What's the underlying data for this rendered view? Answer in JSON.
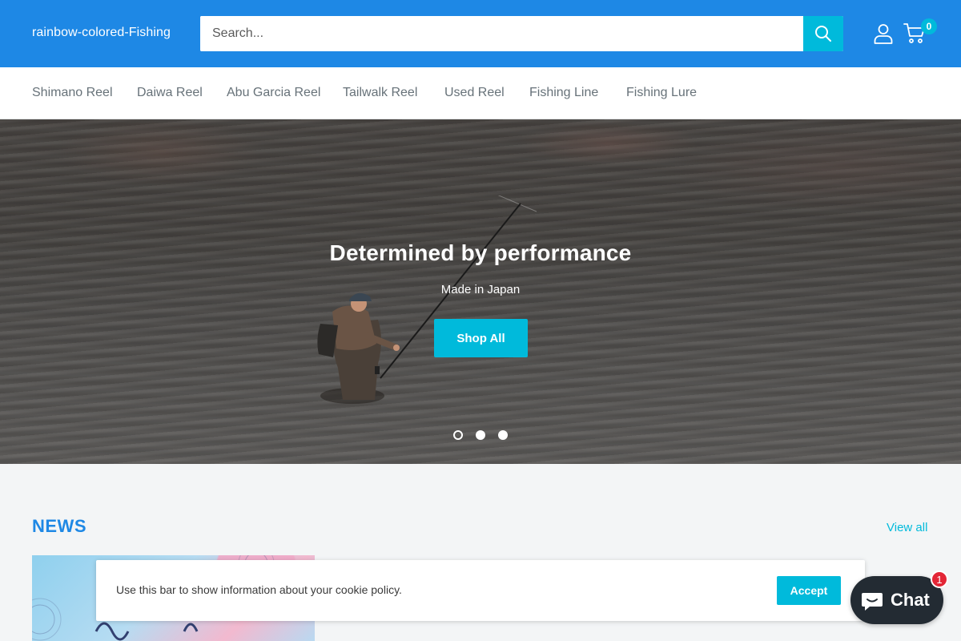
{
  "header": {
    "logo": "rainbow-colored-Fishing",
    "search_placeholder": "Search...",
    "cart_count": "0",
    "icons": {
      "search": "search-icon",
      "account": "user-icon",
      "cart": "cart-icon"
    },
    "colors": {
      "brand": "#1e88e5",
      "accent": "#00badb"
    }
  },
  "nav": {
    "items": [
      {
        "label": "Shimano Reel"
      },
      {
        "label": "Daiwa Reel"
      },
      {
        "label": "Abu Garcia Reel"
      },
      {
        "label": "Tailwalk Reel"
      },
      {
        "label": "Used Reel"
      },
      {
        "label": "Fishing Line"
      },
      {
        "label": "Fishing Lure"
      }
    ]
  },
  "hero": {
    "title": "Determined by performance",
    "subtitle": "Made in Japan",
    "button": "Shop All",
    "slides": 3,
    "active_slide": 1
  },
  "news": {
    "title": "NEWS",
    "view_all": "View all"
  },
  "cookie": {
    "text": "Use this bar to show information about your cookie policy.",
    "accept": "Accept"
  },
  "chat": {
    "label": "Chat",
    "badge": "1",
    "icon": "chat-bubble-icon"
  }
}
